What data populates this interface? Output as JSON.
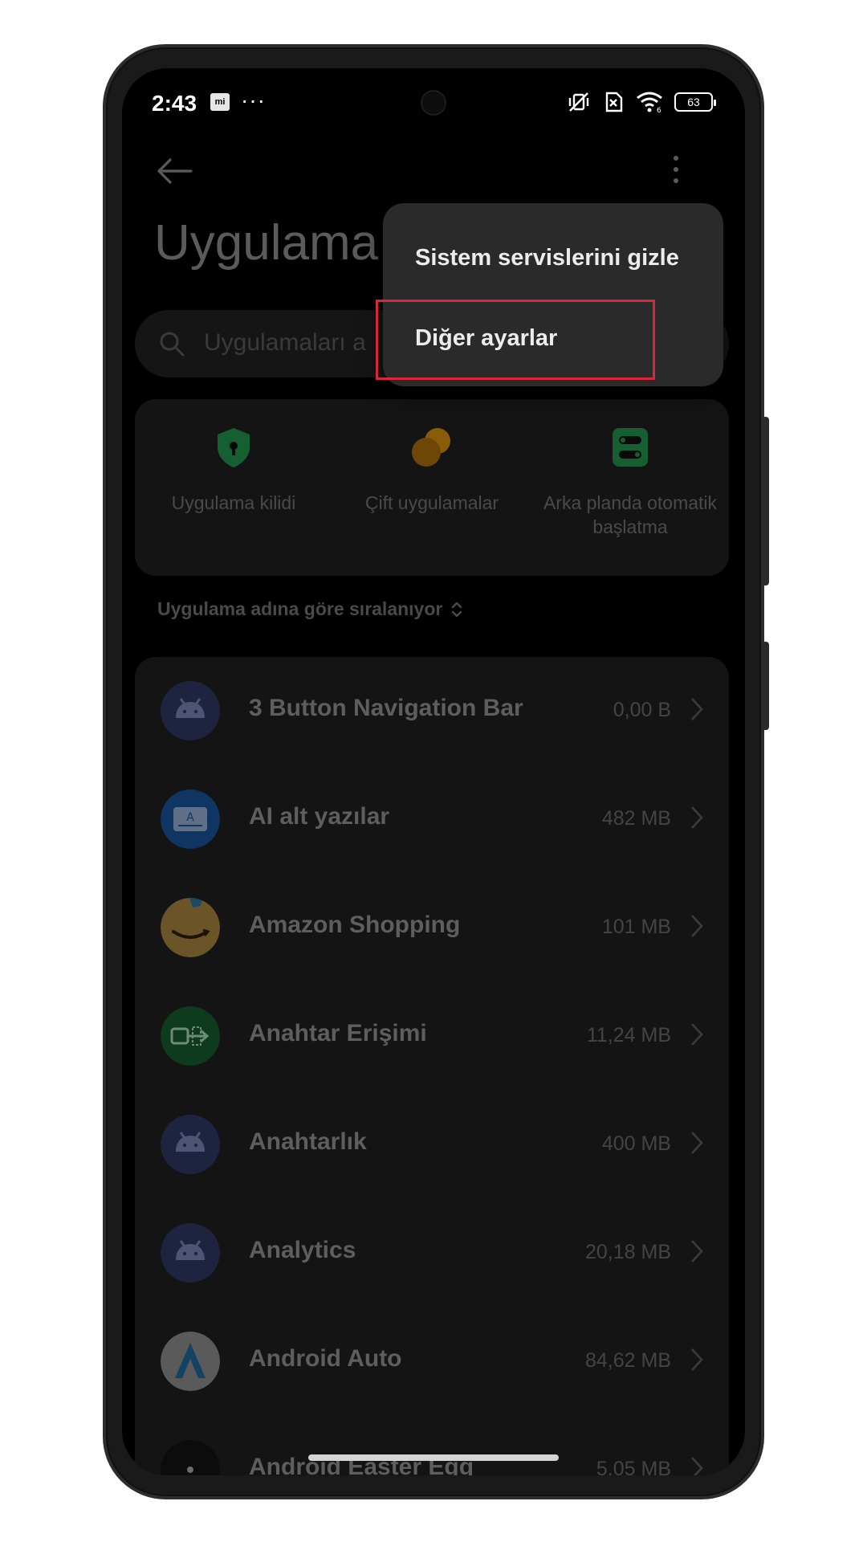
{
  "status_bar": {
    "time": "2:43",
    "mi_badge": "mi",
    "overflow": "···",
    "battery": "63",
    "icons": [
      "vibrate-off-icon",
      "sim-off-icon",
      "wifi-6-icon",
      "battery-icon"
    ]
  },
  "header": {
    "title": "Uygulama",
    "back_icon": "back-arrow-icon",
    "more_icon": "more-vert-icon"
  },
  "search": {
    "placeholder": "Uygulamaları a"
  },
  "quick_actions": [
    {
      "label": "Uygulama kilidi",
      "icon": "shield-lock-icon",
      "color": "#1f8c4c"
    },
    {
      "label": "Çift uygulamalar",
      "icon": "dual-apps-icon",
      "color": "#c8860c"
    },
    {
      "label": "Arka planda otomatik başlatma",
      "icon": "autostart-toggle-icon",
      "color": "#1f8c4c"
    }
  ],
  "sort": {
    "label": "Uygulama adına göre sıralanıyor"
  },
  "apps": [
    {
      "name": "3 Button Navigation Bar",
      "size": "0,00 B",
      "icon": "android-icon"
    },
    {
      "name": "AI alt yazılar",
      "size": "482 MB",
      "icon": "ai-subtitles-icon"
    },
    {
      "name": "Amazon Shopping",
      "size": "101 MB",
      "icon": "amazon-icon"
    },
    {
      "name": "Anahtar Erişimi",
      "size": "11,24 MB",
      "icon": "key-access-icon"
    },
    {
      "name": "Anahtarlık",
      "size": "400 MB",
      "icon": "android-icon"
    },
    {
      "name": "Analytics",
      "size": "20,18 MB",
      "icon": "android-icon"
    },
    {
      "name": "Android Auto",
      "size": "84,62 MB",
      "icon": "android-auto-icon"
    },
    {
      "name": "Android Easter Egg",
      "size": "5,05 MB",
      "icon": "easter-egg-icon"
    }
  ],
  "popup_menu": {
    "items": [
      "Sistem servislerini gizle",
      "Diğer ayarlar"
    ],
    "highlighted": "Diğer ayarlar"
  },
  "colors": {
    "highlight": "#d9263a",
    "popup_bg": "#2a2a2a",
    "screen_bg": "#000000"
  }
}
